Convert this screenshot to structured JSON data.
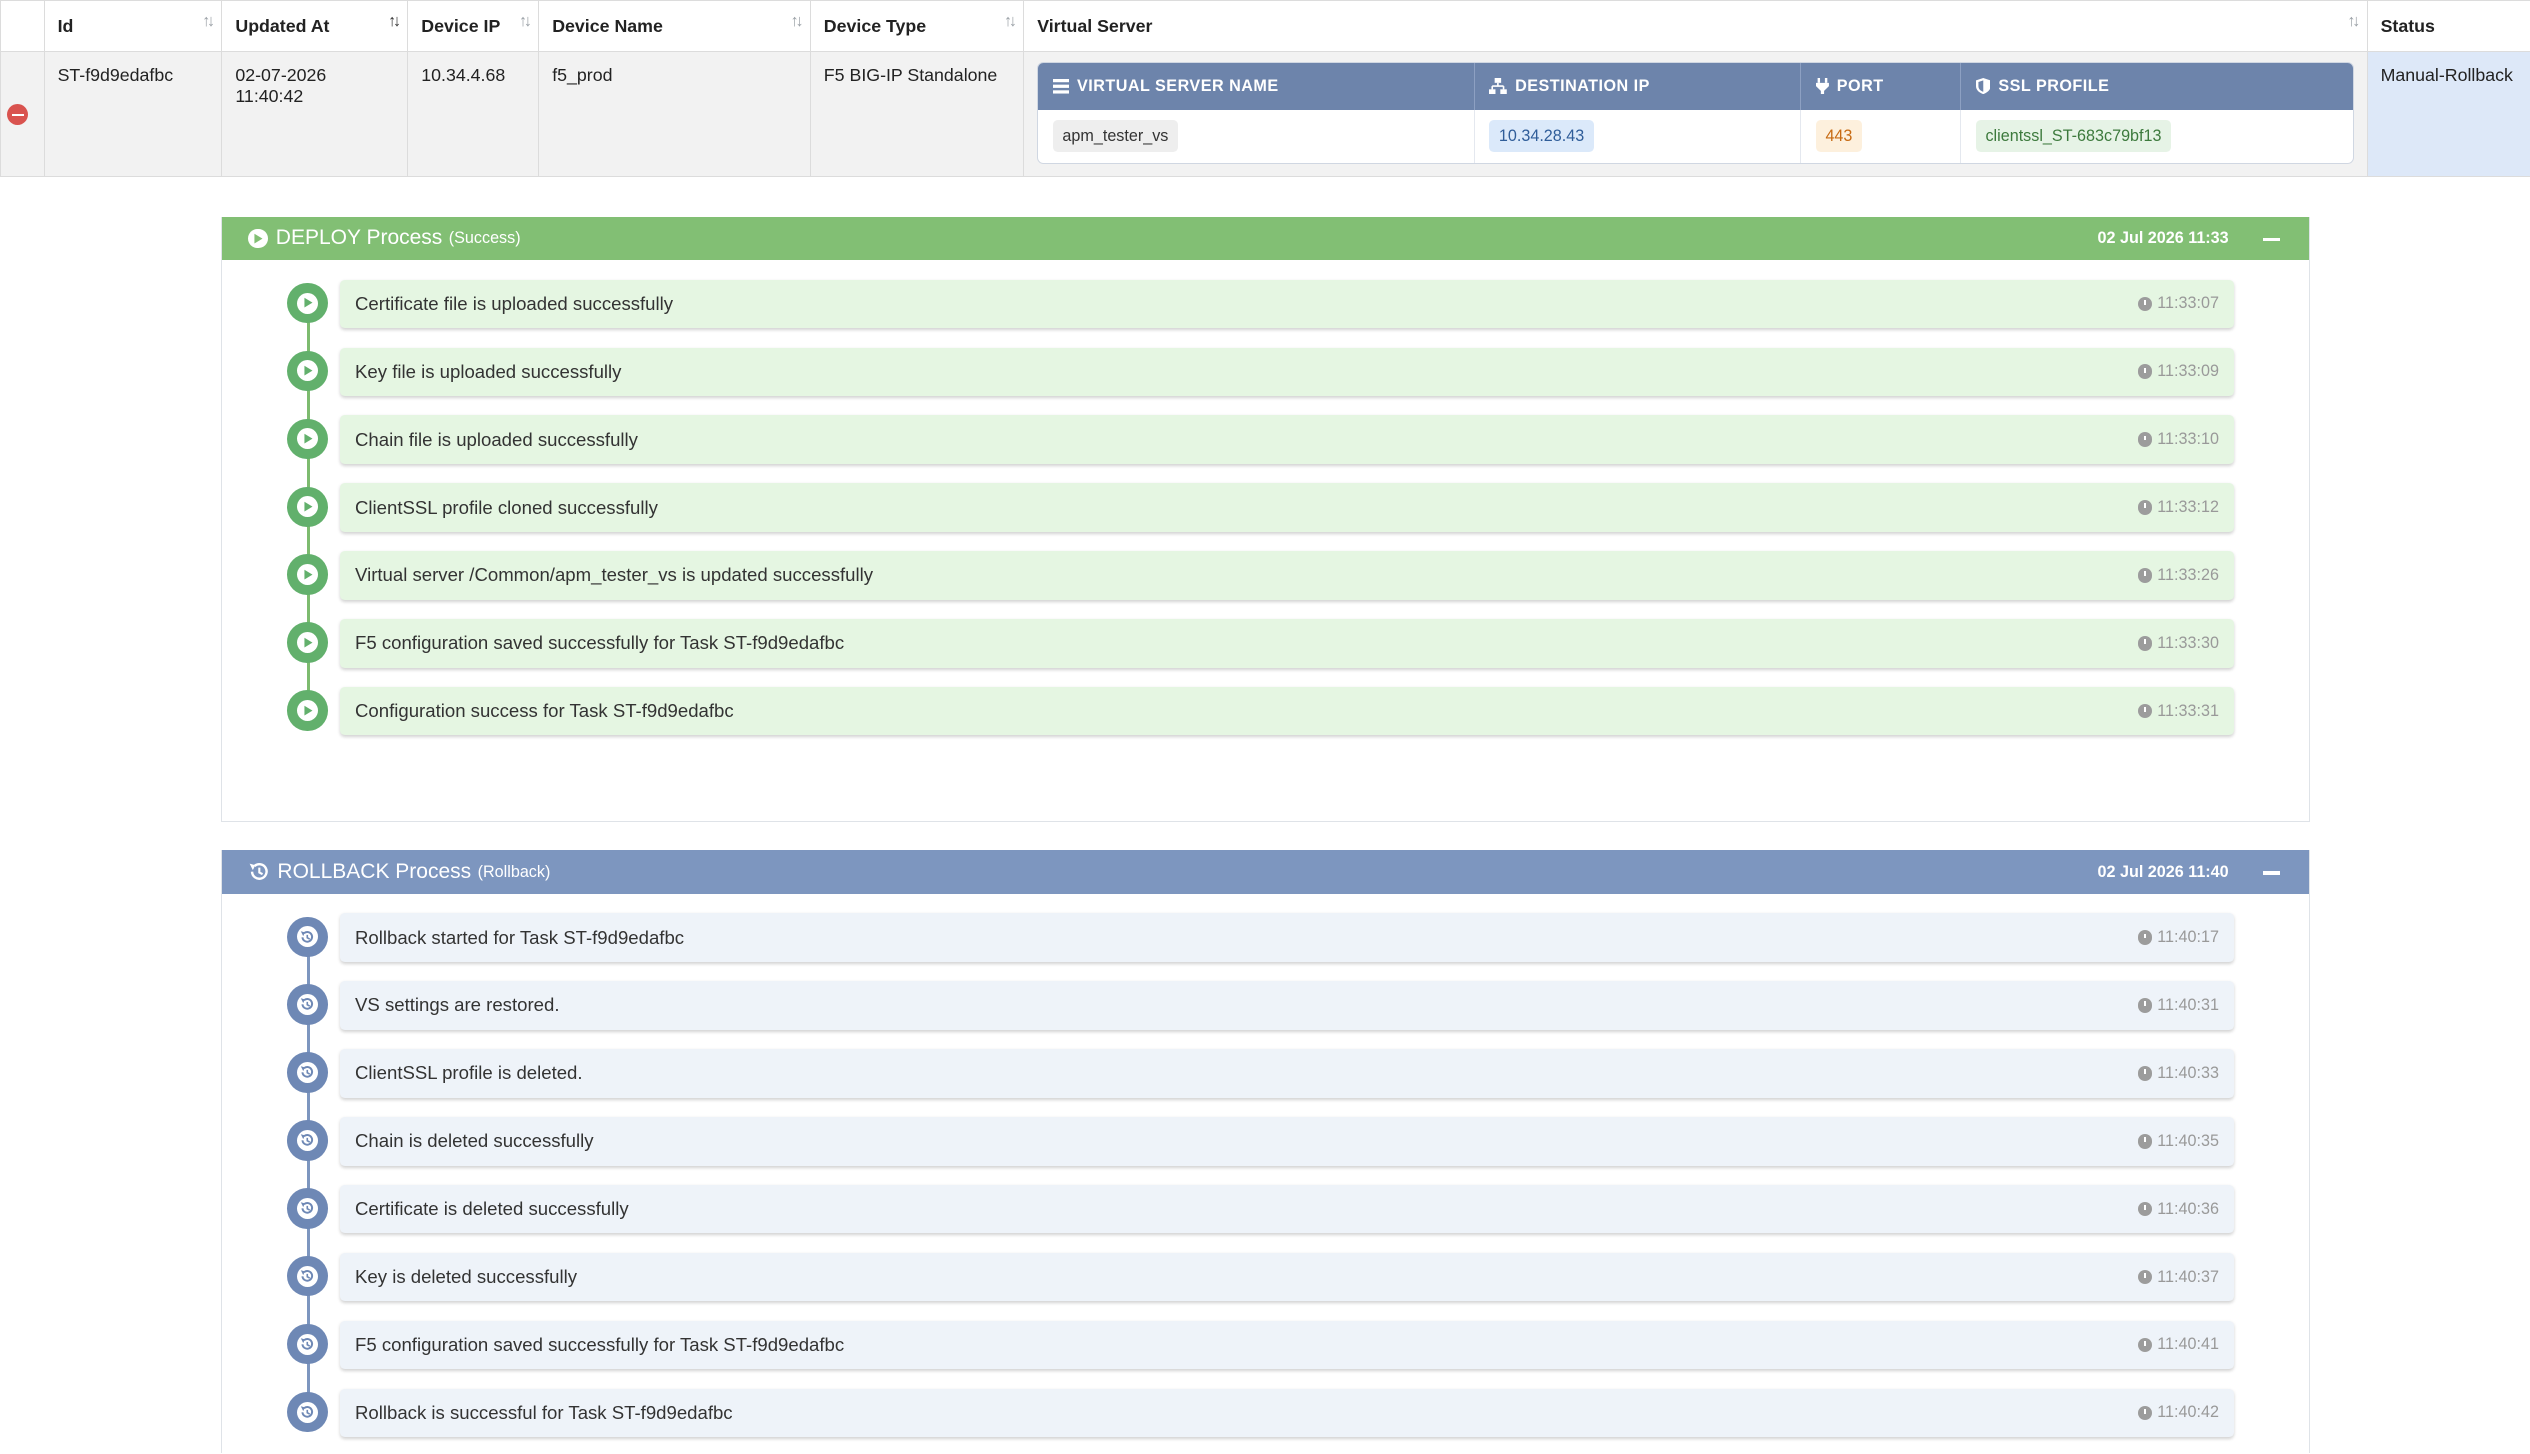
{
  "columns": {
    "id": "Id",
    "updated_at": "Updated At",
    "device_ip": "Device IP",
    "device_name": "Device Name",
    "device_type": "Device Type",
    "virtual_server": "Virtual Server",
    "status": "Status"
  },
  "row": {
    "id": "ST-f9d9edafbc",
    "updated_at": "02-07-2026 11:40:42",
    "device_ip": "10.34.4.68",
    "device_name": "f5_prod",
    "device_type": "F5 BIG-IP Standalone",
    "status": "Manual-Rollback"
  },
  "vs_table": {
    "headers": {
      "name": "VIRTUAL SERVER NAME",
      "destination_ip": "DESTINATION IP",
      "port": "PORT",
      "ssl_profile": "SSL PROFILE"
    },
    "values": {
      "name": "apm_tester_vs",
      "destination_ip": "10.34.28.43",
      "port": "443",
      "ssl_profile": "clientssl_ST-683c79bf13"
    }
  },
  "deploy": {
    "title": "DEPLOY Process",
    "subtitle": "(Success)",
    "date": "02 Jul 2026 11:33",
    "color": "#82bf74",
    "steps": [
      {
        "text": "Certificate file is uploaded successfully",
        "time": "11:33:07"
      },
      {
        "text": "Key file is uploaded successfully",
        "time": "11:33:09"
      },
      {
        "text": "Chain file is uploaded successfully",
        "time": "11:33:10"
      },
      {
        "text": "ClientSSL profile cloned successfully",
        "time": "11:33:12"
      },
      {
        "text": "Virtual server /Common/apm_tester_vs is updated successfully",
        "time": "11:33:26"
      },
      {
        "text": "F5 configuration saved successfully for Task ST-f9d9edafbc",
        "time": "11:33:30"
      },
      {
        "text": "Configuration success for Task ST-f9d9edafbc",
        "time": "11:33:31"
      }
    ]
  },
  "rollback": {
    "title": "ROLLBACK Process",
    "subtitle": "(Rollback)",
    "date": "02 Jul 2026 11:40",
    "color": "#7d96bf",
    "steps": [
      {
        "text": "Rollback started for Task ST-f9d9edafbc",
        "time": "11:40:17"
      },
      {
        "text": "VS settings are restored.",
        "time": "11:40:31"
      },
      {
        "text": "ClientSSL profile is deleted.",
        "time": "11:40:33"
      },
      {
        "text": "Chain is deleted successfully",
        "time": "11:40:35"
      },
      {
        "text": "Certificate is deleted successfully",
        "time": "11:40:36"
      },
      {
        "text": "Key is deleted successfully",
        "time": "11:40:37"
      },
      {
        "text": "F5 configuration saved successfully for Task ST-f9d9edafbc",
        "time": "11:40:41"
      },
      {
        "text": "Rollback is successful for Task ST-f9d9edafbc",
        "time": "11:40:42"
      }
    ]
  },
  "icons": {
    "sort": "sort-icon",
    "collapse_row": "minus-circle-icon",
    "deploy_step": "play-circle-icon",
    "rollback_step": "history-icon",
    "time": "clock-icon"
  }
}
